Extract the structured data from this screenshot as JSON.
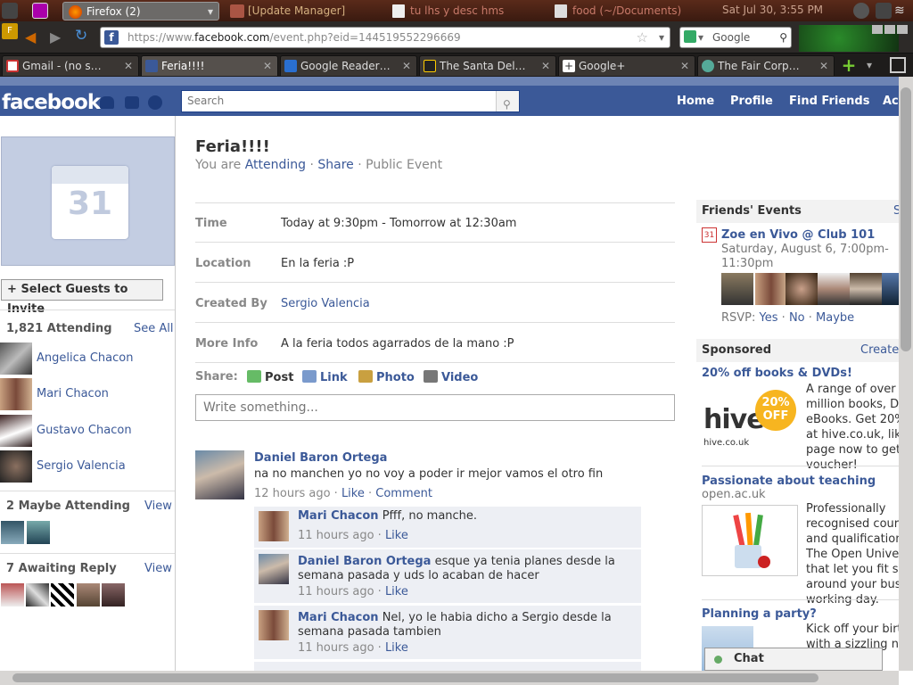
{
  "system_panel": {
    "task_firefox": "Firefox (2)",
    "task_update": "[Update Manager]",
    "task_partial": "tu lhs y desc hms",
    "task_food": "food (~/Documents)",
    "clock": "Sat Jul 30,  3:55 PM"
  },
  "browser": {
    "url_prefix": "https://www.",
    "url_domain": "facebook.com",
    "url_rest": "/event.php?eid=144519552296669",
    "search_engine": "Google",
    "tabs": [
      {
        "label": "Gmail - (no s…"
      },
      {
        "label": "Feria!!!!"
      },
      {
        "label": "Google Reader…"
      },
      {
        "label": "The Santa Del…"
      },
      {
        "label": "Google+"
      },
      {
        "label": "The Fair Corp…"
      }
    ]
  },
  "facebook": {
    "logo": "facebook",
    "search_placeholder": "Search",
    "nav": {
      "home": "Home",
      "profile": "Profile",
      "find_friends": "Find Friends",
      "account": "Ac"
    }
  },
  "left": {
    "calendar_day": "31",
    "invite_button": "Select Guests to Invite",
    "attending_header": "1,821 Attending",
    "see_all": "See All",
    "attendees": [
      "Angelica Chacon",
      "Mari Chacon",
      "Gustavo Chacon",
      "Sergio Valencia"
    ],
    "maybe_header": "2 Maybe Attending",
    "maybe_view": "View",
    "awaiting_header": "7 Awaiting Reply",
    "awaiting_view": "View"
  },
  "event": {
    "title": "Feria!!!!",
    "you_are": "You are",
    "attending": "Attending",
    "share": "Share",
    "public": "Public Event",
    "sep": "·",
    "time_label": "Time",
    "time_value": "Today at 9:30pm - Tomorrow at 12:30am",
    "location_label": "Location",
    "location_value": "En la feria :P",
    "created_label": "Created By",
    "created_value": "Sergio Valencia",
    "info_label": "More Info",
    "info_value": "A la feria todos agarrados de la mano :P"
  },
  "share": {
    "label": "Share:",
    "post": "Post",
    "link": "Link",
    "photo": "Photo",
    "video": "Video",
    "placeholder": "Write something..."
  },
  "post": {
    "author": "Daniel Baron Ortega",
    "text": "na no manchen yo no voy a poder ir mejor vamos el otro fin",
    "time": "12 hours ago",
    "like": "Like",
    "comment": "Comment",
    "comments": [
      {
        "author": "Mari Chacon",
        "text": "Pfff, no manche.",
        "time": "11 hours ago",
        "like": "Like"
      },
      {
        "author": "Daniel Baron Ortega",
        "text": "esque ya tenia planes desde la semana pasada y uds lo acaban de hacer",
        "time": "11 hours ago",
        "like": "Like"
      },
      {
        "author": "Mari Chacon",
        "text": "Nel, yo le habia dicho a Sergio desde la semana pasada tambien",
        "time": "11 hours ago",
        "like": "Like"
      }
    ]
  },
  "right": {
    "friends_events_header": "Friends' Events",
    "fe_see": "S",
    "fe_title": "Zoe en Vivo @ Club 101",
    "fe_date_line1": "Saturday, August 6, 7:00pm-",
    "fe_date_line2": "11:30pm",
    "fe_cal_day": "31",
    "rsvp": "RSVP:",
    "rsvp_yes": "Yes",
    "rsvp_no": "No",
    "rsvp_maybe": "Maybe",
    "sponsored_header": "Sponsored",
    "create": "Create",
    "ad1_title": "20% off books & DVDs!",
    "ad1_lines": [
      "A range of over 4",
      "million books, DVD",
      "eBooks. Get 20%",
      "at hive.co.uk, like",
      "page now to get y",
      "voucher!"
    ],
    "ad1_logo": "hive",
    "ad1_logo_sub": "hive.co.uk",
    "ad1_badge1": "20%",
    "ad1_badge2": "OFF",
    "ad2_title": "Passionate about teaching",
    "ad2_domain": "open.ac.uk",
    "ad2_lines": [
      "Professionally",
      "recognised course",
      "and qualifications",
      "The Open Univers",
      "that let you fit st",
      "around your busy",
      "working day."
    ],
    "ad3_title": "Planning a party?",
    "ad3_lines": [
      "Kick off your birth",
      "with a sizzling ne"
    ],
    "chat": "Chat"
  }
}
